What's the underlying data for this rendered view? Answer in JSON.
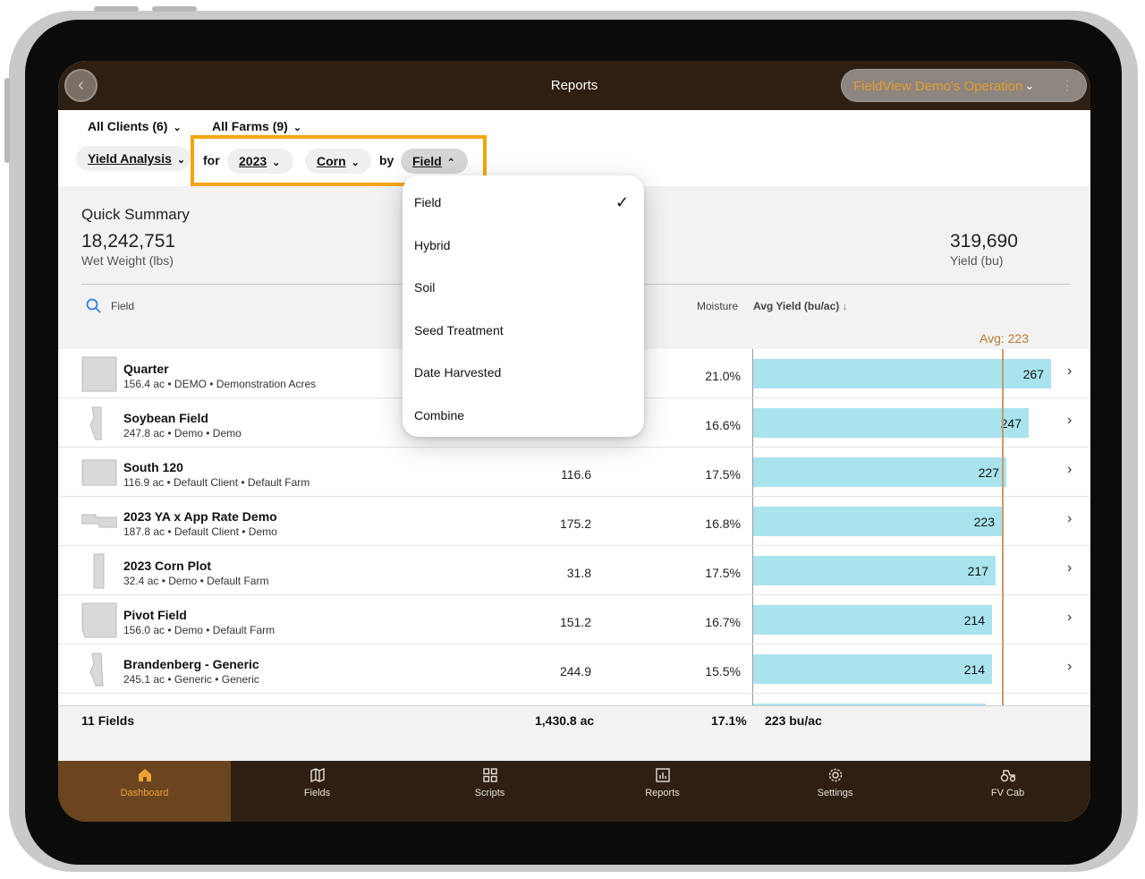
{
  "topbar": {
    "title": "Reports",
    "operation": "FieldView Demo's Operation"
  },
  "filters": {
    "clients": "All Clients (6)",
    "farms": "All Farms (9)",
    "report_type": "Yield Analysis",
    "for_word": "for",
    "year": "2023",
    "crop": "Corn",
    "by_word": "by",
    "group_by": "Field"
  },
  "summary": {
    "title": "Quick Summary",
    "wet_weight_value": "18,242,751",
    "wet_weight_label": "Wet Weight (lbs)",
    "yield_value": "319,690",
    "yield_label": "Yield (bu)"
  },
  "table": {
    "search_placeholder": "Field",
    "moisture_header": "Moisture",
    "avg_yield_header": "Avg Yield (bu/ac)",
    "avg_label": "Avg: 223",
    "avg_value": 223,
    "rows": [
      {
        "name": "Quarter",
        "sub": "156.4 ac • DEMO • Demonstration Acres",
        "area": "",
        "moisture": "21.0%",
        "yield": 267,
        "yield_label": "267"
      },
      {
        "name": "Soybean Field",
        "sub": "247.8 ac • Demo • Demo",
        "area": "",
        "moisture": "16.6%",
        "yield": 247,
        "yield_label": "247"
      },
      {
        "name": "South 120",
        "sub": "116.9 ac • Default Client • Default Farm",
        "area": "116.6",
        "moisture": "17.5%",
        "yield": 227,
        "yield_label": "227"
      },
      {
        "name": "2023 YA x App Rate Demo",
        "sub": "187.8 ac • Default Client • Demo",
        "area": "175.2",
        "moisture": "16.8%",
        "yield": 223,
        "yield_label": "223"
      },
      {
        "name": "2023 Corn Plot",
        "sub": "32.4 ac • Demo • Default Farm",
        "area": "31.8",
        "moisture": "17.5%",
        "yield": 217,
        "yield_label": "217"
      },
      {
        "name": "Pivot Field",
        "sub": "156.0 ac • Demo • Default Farm",
        "area": "151.2",
        "moisture": "16.7%",
        "yield": 214,
        "yield_label": "214"
      },
      {
        "name": "Brandenberg - Generic",
        "sub": "245.1 ac • Generic • Generic",
        "area": "244.9",
        "moisture": "15.5%",
        "yield": 214,
        "yield_label": "214"
      }
    ],
    "footer": {
      "count": "11 Fields",
      "area": "1,430.8 ac",
      "moisture": "17.1%",
      "avg_yield": "223 bu/ac"
    }
  },
  "dropdown": {
    "items": [
      "Field",
      "Hybrid",
      "Soil",
      "Seed Treatment",
      "Date Harvested",
      "Combine"
    ],
    "selected": "Field"
  },
  "nav": {
    "items": [
      "Dashboard",
      "Fields",
      "Scripts",
      "Reports",
      "Settings",
      "FV Cab"
    ],
    "active": "Dashboard"
  },
  "colors": {
    "accent": "#f5a50b",
    "bar": "#a9e4ee",
    "topbar": "#2e1f12",
    "active_tab": "#6a4520"
  }
}
